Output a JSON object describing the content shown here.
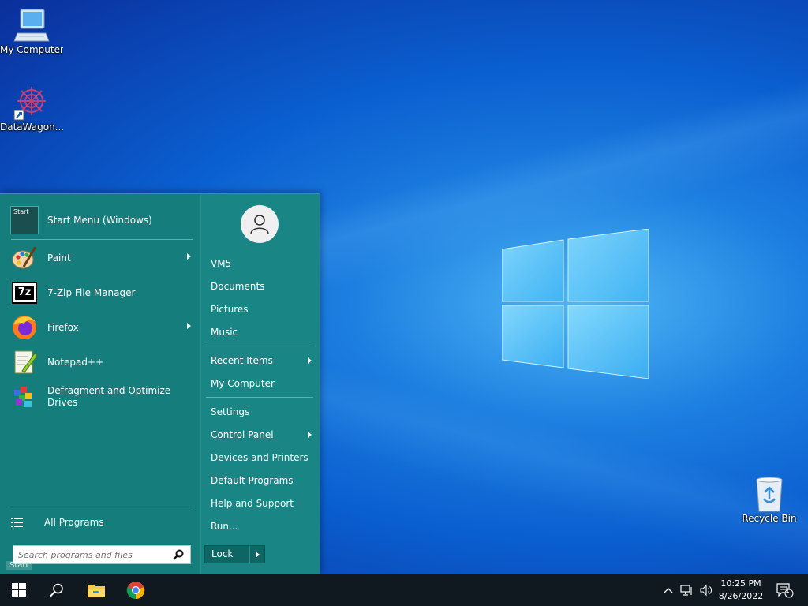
{
  "desktop": {
    "icons": [
      {
        "label": "My Computer"
      },
      {
        "label": "DataWagon..."
      },
      {
        "label": "Recycle Bin"
      }
    ]
  },
  "start_menu": {
    "pinned": [
      {
        "label": "Start Menu (Windows)",
        "icon": "start-menu-icon",
        "submenu": false
      },
      {
        "label": "Paint",
        "icon": "paint-icon",
        "submenu": true
      },
      {
        "label": "7-Zip File Manager",
        "icon": "7zip-icon",
        "submenu": false
      },
      {
        "label": "Firefox",
        "icon": "firefox-icon",
        "submenu": true
      },
      {
        "label": "Notepad++",
        "icon": "notepadpp-icon",
        "submenu": false
      },
      {
        "label": "Defragment and Optimize Drives",
        "icon": "defrag-icon",
        "submenu": false
      }
    ],
    "start_tile_text": "Start",
    "all_programs": "All Programs",
    "search_placeholder": "Search programs and files",
    "right": {
      "items": [
        {
          "label": "VM5",
          "submenu": false
        },
        {
          "label": "Documents",
          "submenu": false
        },
        {
          "label": "Pictures",
          "submenu": false
        },
        {
          "label": "Music",
          "submenu": false
        },
        {
          "label": "Recent Items",
          "submenu": true
        },
        {
          "label": "My Computer",
          "submenu": false
        },
        {
          "label": "Settings",
          "submenu": false
        },
        {
          "label": "Control Panel",
          "submenu": true
        },
        {
          "label": "Devices and Printers",
          "submenu": false
        },
        {
          "label": "Default Programs",
          "submenu": false
        },
        {
          "label": "Help and Support",
          "submenu": false
        },
        {
          "label": "Run...",
          "submenu": false
        }
      ],
      "lock_label": "Lock"
    },
    "start_glyph": "Start"
  },
  "taskbar": {
    "time": "10:25 PM",
    "date": "8/26/2022",
    "notification_count": "1",
    "accent": "#167d7d"
  }
}
